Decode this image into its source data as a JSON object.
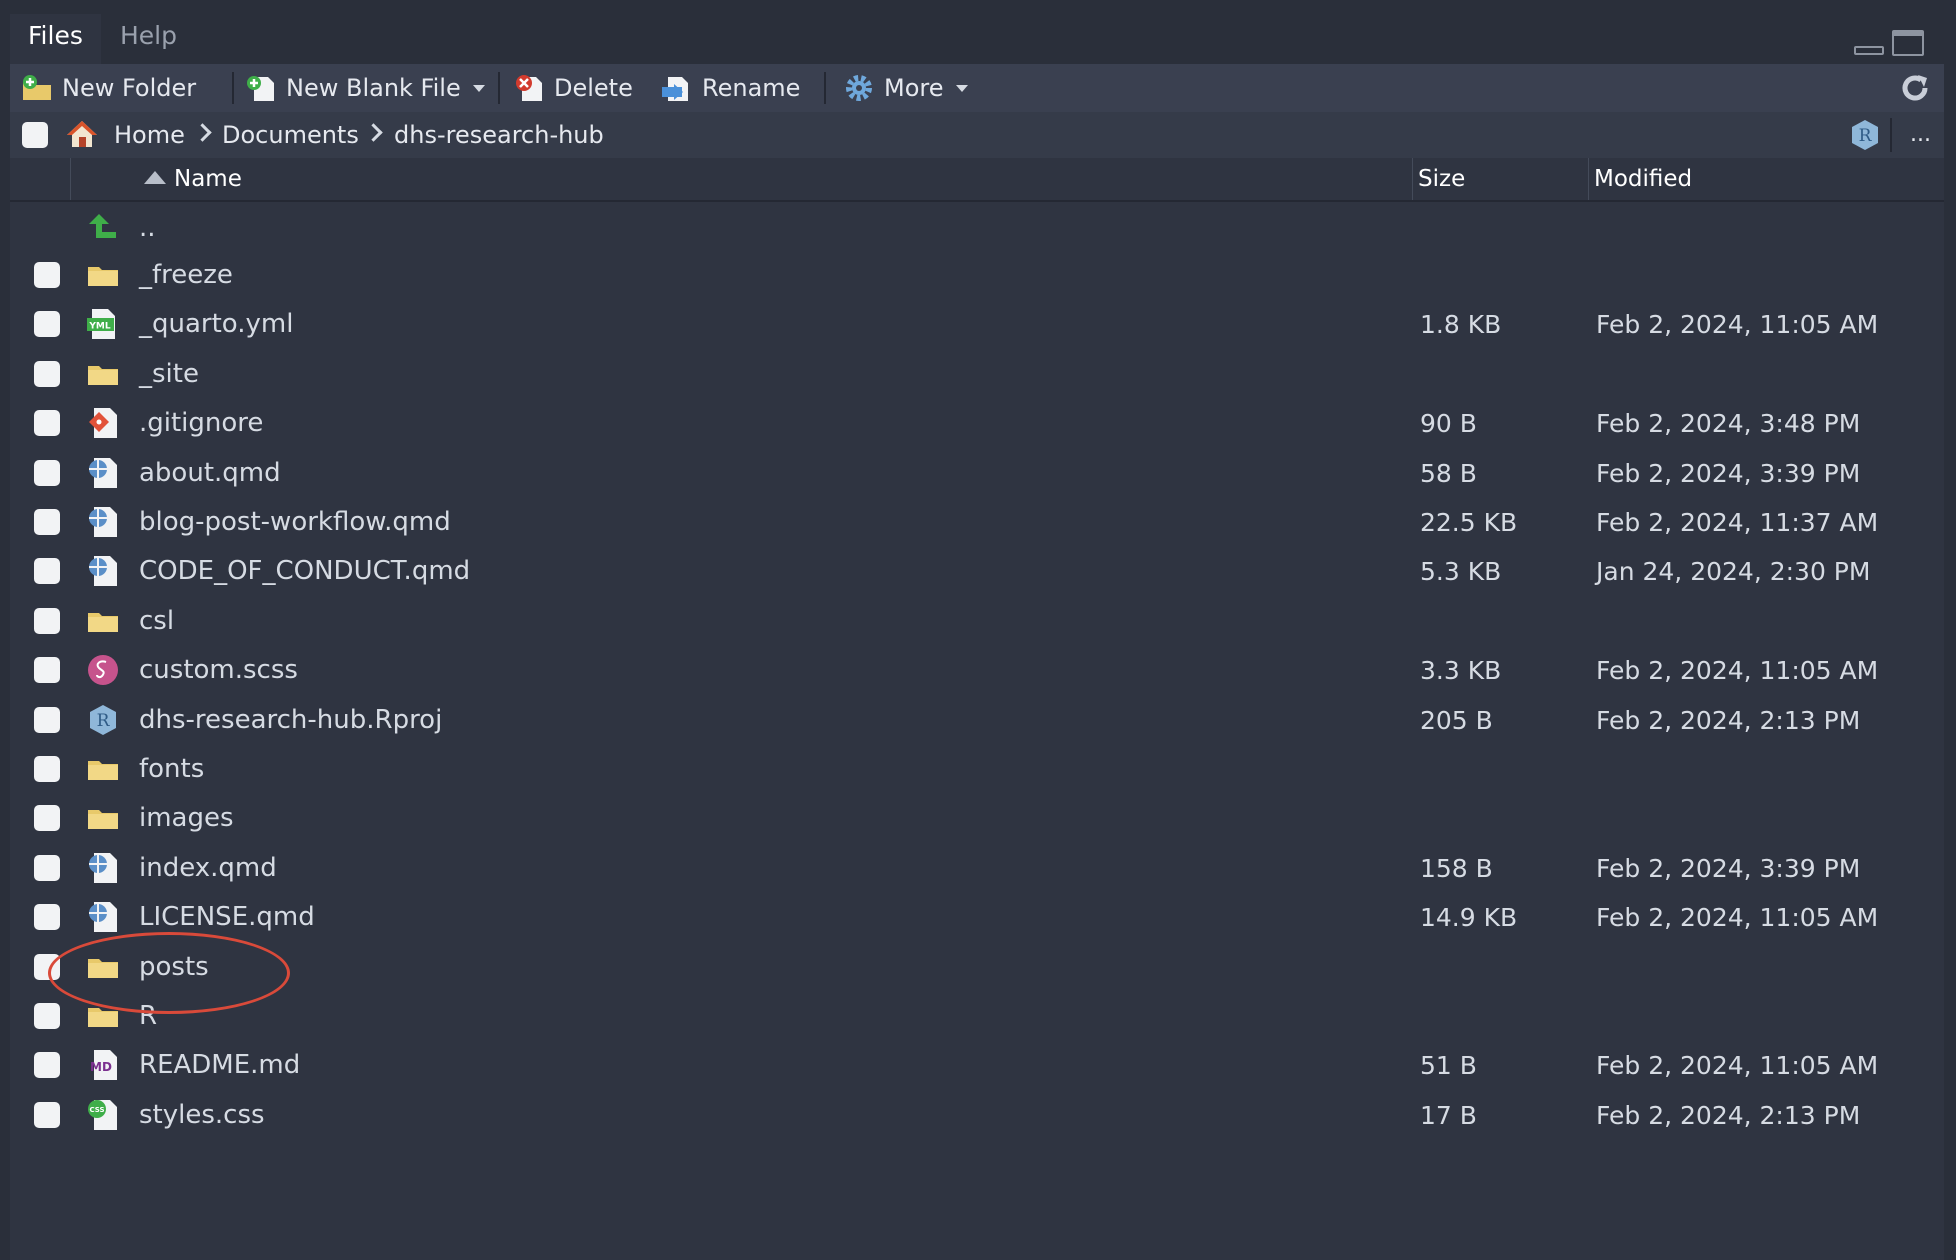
{
  "tabs": {
    "active": "Files",
    "inactive": "Help"
  },
  "toolbar": {
    "new_folder": "New Folder",
    "new_blank_file": "New Blank File",
    "delete": "Delete",
    "rename": "Rename",
    "more": "More"
  },
  "breadcrumb": {
    "home": "Home",
    "documents": "Documents",
    "project": "dhs-research-hub",
    "overflow": "..."
  },
  "columns": {
    "name": "Name",
    "size": "Size",
    "modified": "Modified"
  },
  "colors": {
    "background": "#2f3441",
    "toolbar": "#3a4050",
    "folder": "#e8c96a",
    "highlight": "#d94a3a",
    "up_arrow": "#3fae49"
  },
  "parent_row": {
    "name": ".."
  },
  "files": [
    {
      "name": "_freeze",
      "size": "",
      "modified": "",
      "icon": "folder-icon"
    },
    {
      "name": "_quarto.yml",
      "size": "1.8 KB",
      "modified": "Feb 2, 2024, 11:05 AM",
      "icon": "yml-file-icon"
    },
    {
      "name": "_site",
      "size": "",
      "modified": "",
      "icon": "folder-icon"
    },
    {
      "name": ".gitignore",
      "size": "90 B",
      "modified": "Feb 2, 2024, 3:48 PM",
      "icon": "git-file-icon"
    },
    {
      "name": "about.qmd",
      "size": "58 B",
      "modified": "Feb 2, 2024, 3:39 PM",
      "icon": "quarto-file-icon"
    },
    {
      "name": "blog-post-workflow.qmd",
      "size": "22.5 KB",
      "modified": "Feb 2, 2024, 11:37 AM",
      "icon": "quarto-file-icon"
    },
    {
      "name": "CODE_OF_CONDUCT.qmd",
      "size": "5.3 KB",
      "modified": "Jan 24, 2024, 2:30 PM",
      "icon": "quarto-file-icon"
    },
    {
      "name": "csl",
      "size": "",
      "modified": "",
      "icon": "folder-icon"
    },
    {
      "name": "custom.scss",
      "size": "3.3 KB",
      "modified": "Feb 2, 2024, 11:05 AM",
      "icon": "sass-file-icon"
    },
    {
      "name": "dhs-research-hub.Rproj",
      "size": "205 B",
      "modified": "Feb 2, 2024, 2:13 PM",
      "icon": "rproj-file-icon"
    },
    {
      "name": "fonts",
      "size": "",
      "modified": "",
      "icon": "folder-icon"
    },
    {
      "name": "images",
      "size": "",
      "modified": "",
      "icon": "folder-icon"
    },
    {
      "name": "index.qmd",
      "size": "158 B",
      "modified": "Feb 2, 2024, 3:39 PM",
      "icon": "quarto-file-icon"
    },
    {
      "name": "LICENSE.qmd",
      "size": "14.9 KB",
      "modified": "Feb 2, 2024, 11:05 AM",
      "icon": "quarto-file-icon"
    },
    {
      "name": "posts",
      "size": "",
      "modified": "",
      "icon": "folder-icon"
    },
    {
      "name": "R",
      "size": "",
      "modified": "",
      "icon": "folder-icon"
    },
    {
      "name": "README.md",
      "size": "51 B",
      "modified": "Feb 2, 2024, 11:05 AM",
      "icon": "markdown-file-icon"
    },
    {
      "name": "styles.css",
      "size": "17 B",
      "modified": "Feb 2, 2024, 2:13 PM",
      "icon": "css-file-icon"
    }
  ]
}
